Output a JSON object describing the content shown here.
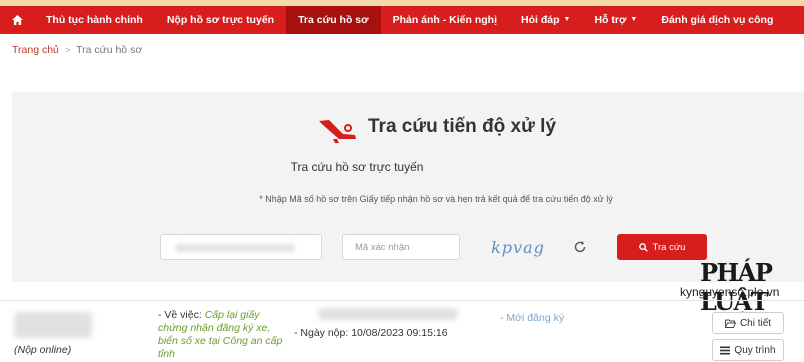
{
  "nav": {
    "home_icon": "home-icon",
    "items": [
      {
        "label": "Thủ tục hành chính"
      },
      {
        "label": "Nộp hồ sơ trực tuyến"
      },
      {
        "label": "Tra cứu hồ sơ"
      },
      {
        "label": "Phản ánh - Kiến nghị"
      },
      {
        "label": "Hỏi đáp"
      },
      {
        "label": "Hỗ trợ"
      },
      {
        "label": "Đánh giá dịch vụ công"
      }
    ],
    "active_index": 2,
    "colors": {
      "bar": "#d81d1d",
      "active": "#a80f0f",
      "top_strip": "#f3d9a8"
    }
  },
  "breadcrumb": {
    "home": "Trang chủ",
    "separator": ">",
    "current": "Tra cứu hồ sơ"
  },
  "search_panel": {
    "title": "Tra cứu tiến độ xử lý",
    "subtitle": "Tra cứu hồ sơ trực tuyến",
    "note": "* Nhập Mã số hồ sơ trên Giấy tiếp nhận hồ sơ và hẹn trả kết quả để tra cứu tiến độ xử lý",
    "captcha_placeholder": "Mã xác nhận",
    "captcha_text": "kpvag",
    "search_button": "Tra cứu",
    "icons": {
      "title": "plane-search-icon",
      "refresh": "refresh-icon",
      "search": "search-icon"
    }
  },
  "watermark": {
    "brand": "PHÁP LUẬT",
    "site": "kynguyenso.plo.vn"
  },
  "result_row": {
    "submit_type": "(Nộp online)",
    "subject_prefix": "- Về việc:",
    "subject_value": "Cấp lại giấy chứng nhận đăng ký xe, biển số xe tại Công an cấp tỉnh",
    "submit_date": "- Ngày nộp: 10/08/2023 09:15:16",
    "status": "- Mới đăng ký",
    "detail_button": "Chi tiết",
    "process_button": "Quy trình",
    "icons": {
      "detail": "folder-open-icon",
      "process": "list-icon"
    }
  }
}
